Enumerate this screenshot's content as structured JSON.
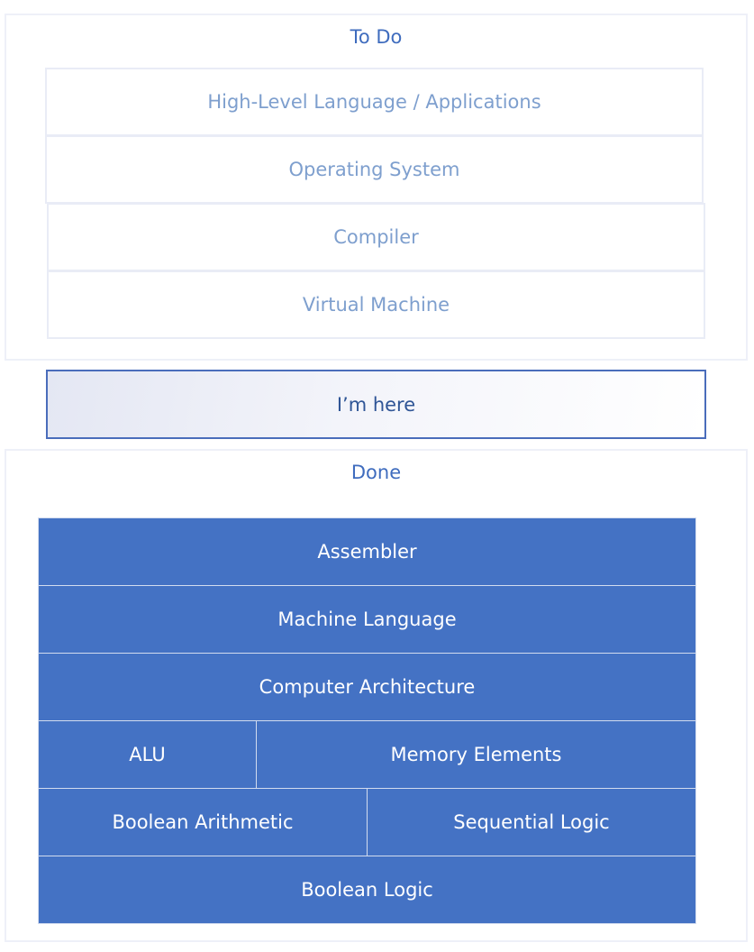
{
  "todo": {
    "title": "To Do",
    "layers": [
      "High-Level Language / Applications",
      "Operating System",
      "Compiler",
      "Virtual Machine"
    ]
  },
  "current": {
    "label": "I’m here"
  },
  "done": {
    "title": "Done",
    "layers": {
      "assembler": "Assembler",
      "machine_language": "Machine Language",
      "computer_architecture": "Computer Architecture",
      "alu": "ALU",
      "memory_elements": "Memory Elements",
      "boolean_arithmetic": "Boolean Arithmetic",
      "sequential_logic": "Sequential Logic",
      "boolean_logic": "Boolean Logic"
    }
  },
  "colors": {
    "done_fill": "#4472c4",
    "here_border": "#4a6dbb",
    "todo_text": "#7e9fce",
    "title_text": "#3f6cbe"
  }
}
